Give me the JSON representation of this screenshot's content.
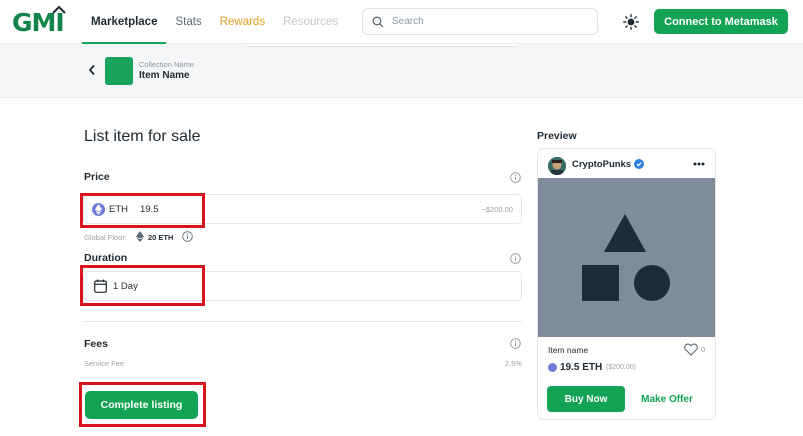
{
  "header": {
    "logo_text": "GMI",
    "nav": [
      {
        "label": "Marketplace",
        "active": true
      },
      {
        "label": "Stats",
        "active": false
      },
      {
        "label": "Rewards",
        "active": false
      },
      {
        "label": "Resources",
        "active": false
      }
    ],
    "search_placeholder": "Search",
    "connect_label": "Connect to Metamask"
  },
  "breadcrumb": {
    "collection_name": "Collection Name",
    "item_name": "Item Name"
  },
  "form": {
    "title": "List item for sale",
    "price": {
      "label": "Price",
      "currency": "ETH",
      "value": "19.5",
      "usd": "~$200.00"
    },
    "floor": {
      "label": "Global Floor:",
      "value": "20 ETH"
    },
    "duration": {
      "label": "Duration",
      "value": "1 Day"
    },
    "fees": {
      "label": "Fees",
      "service_fee_label": "Service Fee",
      "service_fee_value": "2.5%"
    },
    "submit_label": "Complete listing"
  },
  "preview": {
    "title": "Preview",
    "creator": "CryptoPunks",
    "item_name": "Item name",
    "likes": "0",
    "price": "19.5 ETH",
    "price_usd": "($200.00)",
    "buy_label": "Buy Now",
    "offer_label": "Make Offer"
  },
  "colors": {
    "brand": "#12a454",
    "highlight": "#d8141e",
    "rewards": "#e0a11f",
    "media_bg": "#7e8d99",
    "shape": "#1f2b35"
  }
}
